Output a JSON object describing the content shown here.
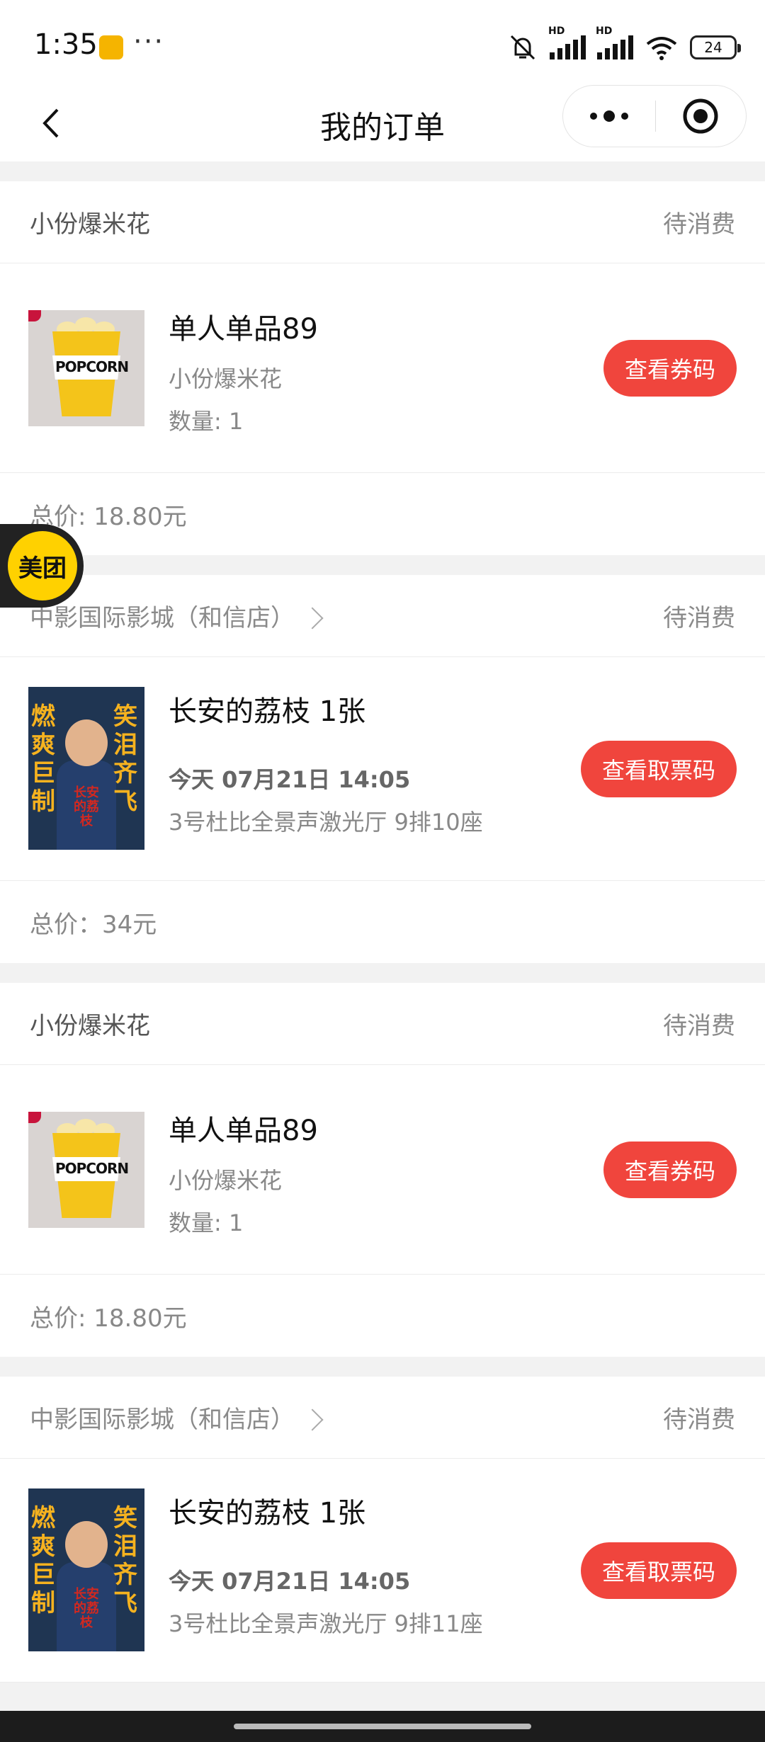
{
  "status_bar": {
    "time": "1:35",
    "dots": "···",
    "hd": "HD",
    "battery": "24"
  },
  "nav": {
    "title": "我的订单"
  },
  "badge": "美团",
  "popcorn_cup_text": "POPCORN",
  "orders": [
    {
      "shop": "小份爆米花",
      "status": "待消费",
      "item_title": "单人单品89",
      "item_desc": "小份爆米花",
      "item_qty": "数量: 1",
      "button": "查看券码",
      "total": "总价: 18.80元"
    },
    {
      "shop": "中影国际影城（和信店）",
      "status": "待消费",
      "movie_title": "长安的荔枝 1张",
      "showtime": "今天 07月21日 14:05",
      "seat": "3号杜比全景声激光厅 9排10座",
      "button": "查看取票码",
      "total": "总价：34元",
      "poster": {
        "left": "燃爽巨制",
        "right": "笑泪齐飞",
        "logo": "长安的荔枝"
      }
    },
    {
      "shop": "小份爆米花",
      "status": "待消费",
      "item_title": "单人单品89",
      "item_desc": "小份爆米花",
      "item_qty": "数量: 1",
      "button": "查看券码",
      "total": "总价: 18.80元"
    },
    {
      "shop": "中影国际影城（和信店）",
      "status": "待消费",
      "movie_title": "长安的荔枝 1张",
      "showtime": "今天 07月21日 14:05",
      "seat": "3号杜比全景声激光厅 9排11座",
      "button": "查看取票码",
      "poster": {
        "left": "燃爽巨制",
        "right": "笑泪齐飞",
        "logo": "长安的荔枝"
      }
    }
  ],
  "colors": {
    "accent": "#f0453d",
    "badge": "#ffd100",
    "poster_text": "#f5b21f"
  },
  "icons": [
    "back-arrow-icon",
    "more-dots-icon",
    "target-circle-icon",
    "chevron-right-icon",
    "mute-bell-icon",
    "wifi-icon",
    "signal-icon",
    "battery-icon"
  ]
}
